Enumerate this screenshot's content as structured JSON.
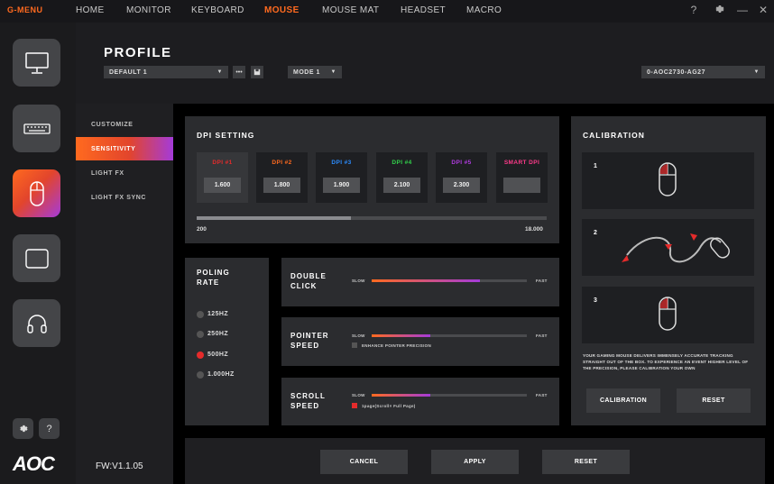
{
  "app": {
    "brand": "G-MENU"
  },
  "nav": [
    {
      "label": "HOME",
      "active": false
    },
    {
      "label": "MONITOR",
      "active": false
    },
    {
      "label": "KEYBOARD",
      "active": false
    },
    {
      "label": "MOUSE",
      "active": true
    },
    {
      "label": "MOUSE MAT",
      "active": false
    },
    {
      "label": "HEADSET",
      "active": false
    },
    {
      "label": "MACRO",
      "active": false
    }
  ],
  "window_controls": {
    "help": "?",
    "settings_icon": "gear-icon",
    "minimize": "—",
    "close": "✕"
  },
  "sidebar": {
    "devices": [
      "monitor-icon",
      "keyboard-icon",
      "mouse-icon",
      "mouse-mat-icon",
      "headset-icon"
    ],
    "active_device": "mouse",
    "bottom": {
      "settings_icon": "gear-icon",
      "help": "?"
    },
    "logo": "AOC"
  },
  "profile": {
    "title": "PROFILE",
    "profile_select": "DEFAULT 1",
    "more": "•••",
    "mode_select": "MODE 1",
    "device_select": "0-AOC2730-AG27"
  },
  "submenu": [
    {
      "label": "CUSTOMIZE",
      "active": false
    },
    {
      "label": "SENSITIVITY",
      "active": true
    },
    {
      "label": "LIGHT FX",
      "active": false
    },
    {
      "label": "LIGHT FX SYNC",
      "active": false
    }
  ],
  "firmware": "FW:V1.1.05",
  "dpi": {
    "title": "DPI SETTING",
    "cards": [
      {
        "label": "DPI #1",
        "value": "1.600",
        "color": "#e52b2b",
        "active": true
      },
      {
        "label": "DPI #2",
        "value": "1.800",
        "color": "#ff6a1f",
        "active": false
      },
      {
        "label": "DPI #3",
        "value": "1.900",
        "color": "#2b8cff",
        "active": false
      },
      {
        "label": "DPI #4",
        "value": "2.100",
        "color": "#32d24b",
        "active": false
      },
      {
        "label": "DPI #5",
        "value": "2.300",
        "color": "#b03be0",
        "active": false
      },
      {
        "label": "SMART DPI",
        "value": "",
        "color": "#ff3a8a",
        "active": false
      }
    ],
    "min": "200",
    "max": "18.000",
    "slider_fraction": 0.44
  },
  "polling": {
    "title_line1": "POLING",
    "title_line2": "RATE",
    "options": [
      {
        "label": "125HZ",
        "selected": false
      },
      {
        "label": "250HZ",
        "selected": false
      },
      {
        "label": "500HZ",
        "selected": true
      },
      {
        "label": "1.000HZ",
        "selected": false
      }
    ]
  },
  "speeds": [
    {
      "title_line1": "DOUBLE",
      "title_line2": "CLICK",
      "slow": "SLOW",
      "fast": "FAST",
      "fraction": 0.7,
      "checkbox": null
    },
    {
      "title_line1": "POINTER",
      "title_line2": "SPEED",
      "slow": "SLOW",
      "fast": "FAST",
      "fraction": 0.38,
      "checkbox": {
        "label": "ENHANCE POINTER PRECISION",
        "checked": false
      }
    },
    {
      "title_line1": "SCROLL",
      "title_line2": "SPEED",
      "slow": "SLOW",
      "fast": "FAST",
      "fraction": 0.38,
      "checkbox": {
        "label": "1page(Scroll× Full Page)",
        "checked": true
      }
    }
  ],
  "calibration": {
    "title": "CALIBRATION",
    "steps": [
      "1",
      "2",
      "3"
    ],
    "description": "YOUR GAMING MOUSE DELIVERS IMMENSELY ACCURATE TRACKING STRAIGHT OUT OF THE BOX. TO EXPERIENCE AN EVENT HIGHER LEVEL OF THE PRECISION, PLEASE CALIBRATION YOUR OWN",
    "calibration_button": "CALIBRATION",
    "reset_button": "RESET"
  },
  "footer": {
    "cancel": "CANCEL",
    "apply": "APPLY",
    "reset": "RESET"
  }
}
